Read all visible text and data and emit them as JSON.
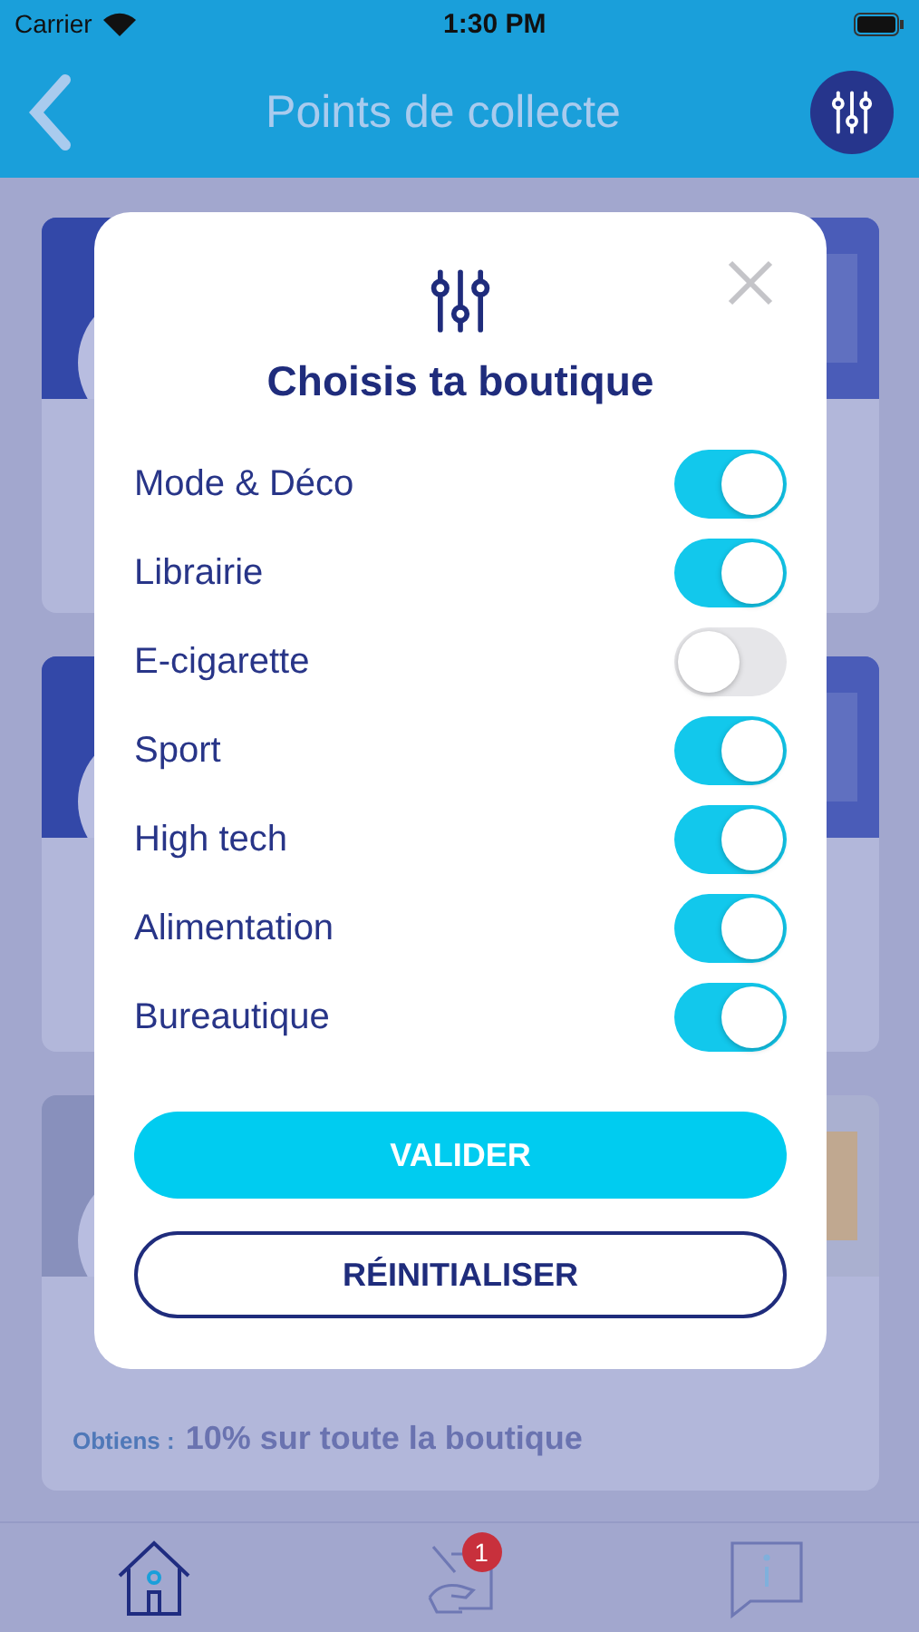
{
  "status_bar": {
    "carrier": "Carrier",
    "time": "1:30 PM"
  },
  "header": {
    "title": "Points de collecte"
  },
  "cards": [
    {
      "kind": "picture"
    },
    {
      "kind": "picture"
    },
    {
      "kind": "picture",
      "offer_label": "Obtiens :",
      "offer": "10% sur toute la boutique"
    }
  ],
  "modal": {
    "title": "Choisis ta boutique",
    "options": [
      {
        "label": "Mode & Déco",
        "on": true
      },
      {
        "label": "Librairie",
        "on": true
      },
      {
        "label": "E-cigarette",
        "on": false
      },
      {
        "label": "Sport",
        "on": true
      },
      {
        "label": "High tech",
        "on": true
      },
      {
        "label": "Alimentation",
        "on": true
      },
      {
        "label": "Bureautique",
        "on": true
      }
    ],
    "buttons": [
      {
        "label": "VALIDER",
        "kind": "primary"
      },
      {
        "label": "RÉINITIALISER",
        "kind": "outline"
      }
    ]
  },
  "tab_bar": {
    "items": [
      {
        "kind": "home",
        "selected": true
      },
      {
        "kind": "recycle",
        "selected": false,
        "badge": "1"
      },
      {
        "kind": "info",
        "selected": false
      }
    ]
  }
}
